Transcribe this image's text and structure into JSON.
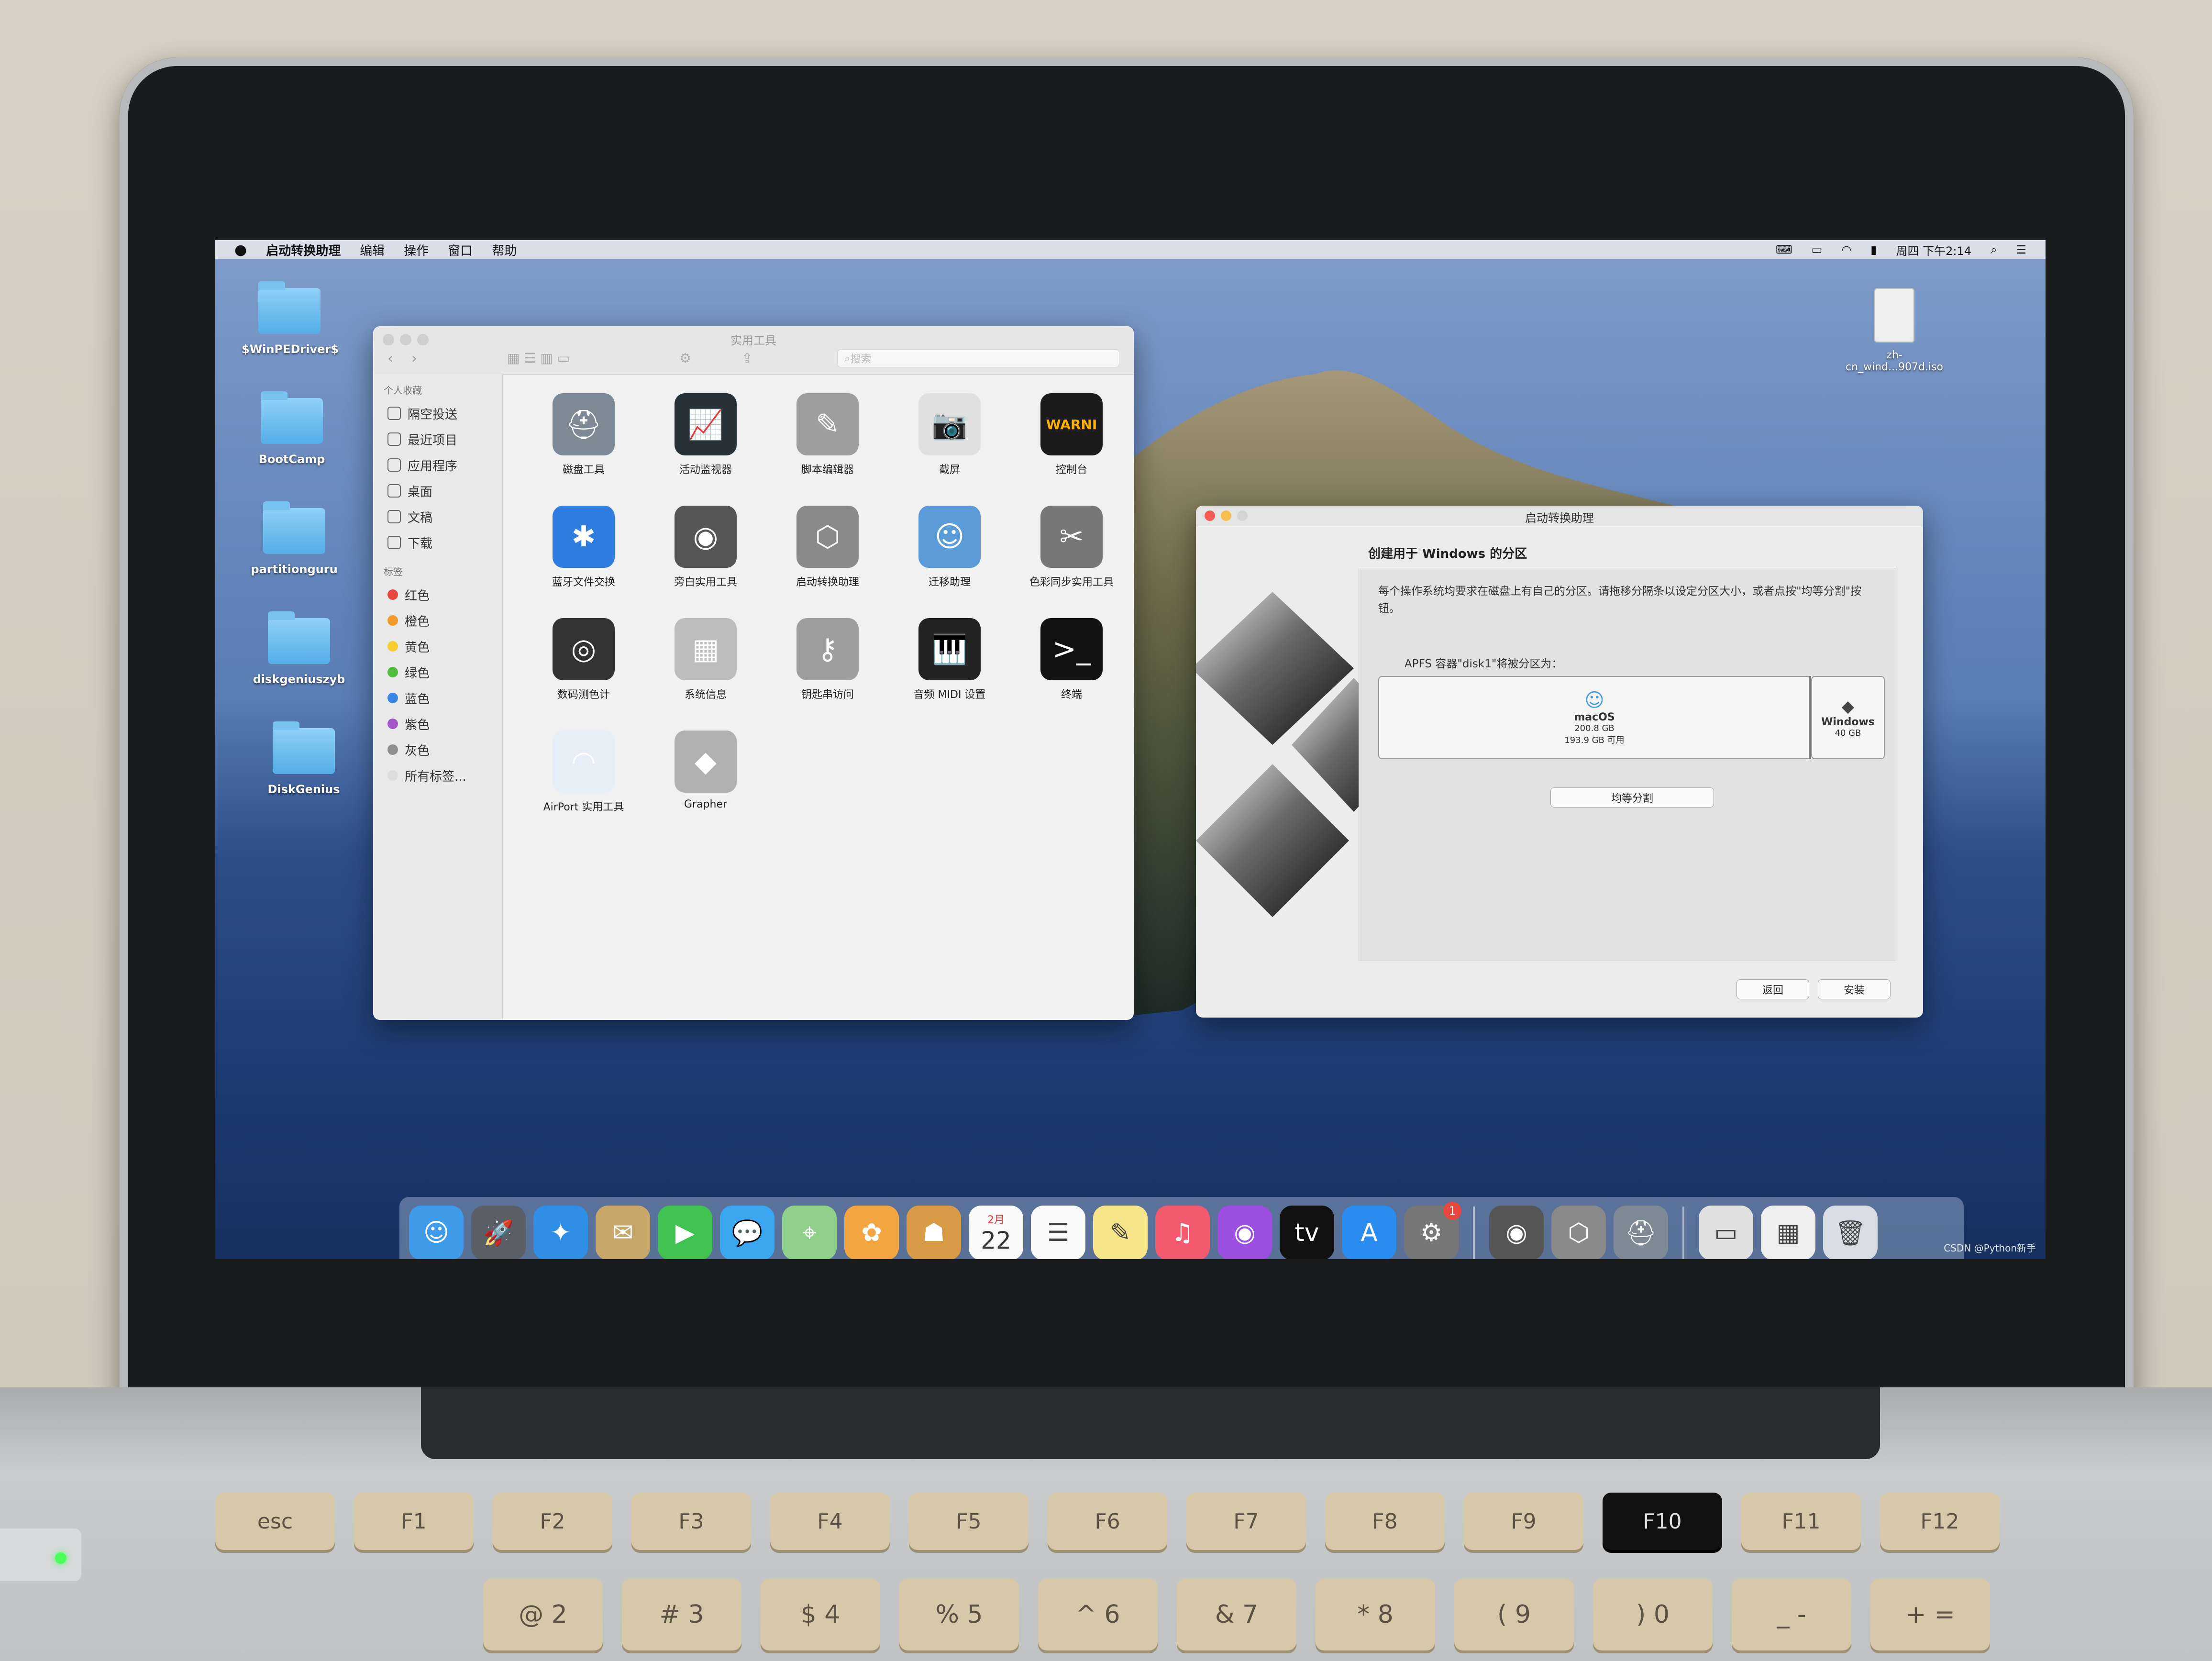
{
  "menubar": {
    "app_name": "启动转换助理",
    "menus": [
      "编辑",
      "操作",
      "窗口",
      "帮助"
    ],
    "clock": "周四 下午2:14"
  },
  "desktop_icons": [
    {
      "label": "$WinPEDriver$"
    },
    {
      "label": "BootCamp"
    },
    {
      "label": "partitionguru"
    },
    {
      "label": "diskgeniuszyb"
    },
    {
      "label": "DiskGenius"
    }
  ],
  "desktop_file": {
    "label_line1": "zh-",
    "label_line2": "cn_wind...907d.iso"
  },
  "finder": {
    "title": "实用工具",
    "search_placeholder": "搜索",
    "sidebar": {
      "favorites_heading": "个人收藏",
      "favorites": [
        "隔空投送",
        "最近项目",
        "应用程序",
        "桌面",
        "文稿",
        "下载"
      ],
      "tags_heading": "标签",
      "tags": [
        {
          "label": "红色",
          "color": "#e8463f"
        },
        {
          "label": "橙色",
          "color": "#f39a2b"
        },
        {
          "label": "黄色",
          "color": "#f5cf30"
        },
        {
          "label": "绿色",
          "color": "#4fbe3d"
        },
        {
          "label": "蓝色",
          "color": "#3a86e6"
        },
        {
          "label": "紫色",
          "color": "#a456c9"
        },
        {
          "label": "灰色",
          "color": "#8e8e8e"
        },
        {
          "label": "所有标签...",
          "color": "#dddddd"
        }
      ]
    },
    "apps": [
      {
        "label": "磁盘工具",
        "icon": "disk-utility-icon",
        "glyph": "⛑",
        "bg": "#7d8a96"
      },
      {
        "label": "活动监视器",
        "icon": "activity-monitor-icon",
        "glyph": "📈",
        "bg": "#263238"
      },
      {
        "label": "脚本编辑器",
        "icon": "script-editor-icon",
        "glyph": "✎",
        "bg": "#9e9e9e"
      },
      {
        "label": "截屏",
        "icon": "screenshot-icon",
        "glyph": "📷",
        "bg": "#e0e0e0"
      },
      {
        "label": "控制台",
        "icon": "console-icon",
        "glyph": "WARNI",
        "bg": "#1c1c1c"
      },
      {
        "label": "蓝牙文件交换",
        "icon": "bluetooth-icon",
        "glyph": "✱",
        "bg": "#2f7de1"
      },
      {
        "label": "旁白实用工具",
        "icon": "voiceover-icon",
        "glyph": "◉",
        "bg": "#555555"
      },
      {
        "label": "启动转换助理",
        "icon": "bootcamp-assistant-icon",
        "glyph": "⬡",
        "bg": "#8a8a8a"
      },
      {
        "label": "迁移助理",
        "icon": "migration-assistant-icon",
        "glyph": "☺",
        "bg": "#5a9bd8"
      },
      {
        "label": "色彩同步实用工具",
        "icon": "colorsync-icon",
        "glyph": "✂",
        "bg": "#777777"
      },
      {
        "label": "数码测色计",
        "icon": "digital-color-meter-icon",
        "glyph": "◎",
        "bg": "#333333"
      },
      {
        "label": "系统信息",
        "icon": "system-information-icon",
        "glyph": "▦",
        "bg": "#bdbdbd"
      },
      {
        "label": "钥匙串访问",
        "icon": "keychain-access-icon",
        "glyph": "⚷",
        "bg": "#9e9e9e"
      },
      {
        "label": "音频 MIDI 设置",
        "icon": "audio-midi-icon",
        "glyph": "🎹",
        "bg": "#222222"
      },
      {
        "label": "终端",
        "icon": "terminal-icon",
        "glyph": ">_",
        "bg": "#111111"
      },
      {
        "label": "AirPort 实用工具",
        "icon": "airport-utility-icon",
        "glyph": "◠",
        "bg": "#e6eef7"
      },
      {
        "label": "Grapher",
        "icon": "grapher-icon",
        "glyph": "◆",
        "bg": "#b0b0b0"
      }
    ]
  },
  "bootcamp": {
    "title": "启动转换助理",
    "heading": "创建用于 Windows 的分区",
    "description": "每个操作系统均要求在磁盘上有自己的分区。请拖移分隔条以设定分区大小，或者点按\"均等分割\"按钮。",
    "apfs_label": "APFS 容器\"disk1\"将被分区为：",
    "mac_partition": {
      "name": "macOS",
      "size": "200.8 GB",
      "free": "193.9 GB 可用"
    },
    "win_partition": {
      "name": "Windows",
      "size": "40 GB"
    },
    "equal_split_label": "均等分割",
    "back_label": "返回",
    "install_label": "安装"
  },
  "dock": {
    "apps": [
      {
        "icon": "finder-icon",
        "glyph": "☺",
        "bg": "#3d9be9"
      },
      {
        "icon": "launchpad-icon",
        "glyph": "🚀",
        "bg": "#5a5f66"
      },
      {
        "icon": "safari-icon",
        "glyph": "✦",
        "bg": "#2f8ee6"
      },
      {
        "icon": "mail-icon",
        "glyph": "✉",
        "bg": "#c8a86a"
      },
      {
        "icon": "facetime-icon",
        "glyph": "▶",
        "bg": "#3fc24f"
      },
      {
        "icon": "messages-icon",
        "glyph": "💬",
        "bg": "#3aa6f0"
      },
      {
        "icon": "maps-icon",
        "glyph": "⌖",
        "bg": "#8fd18a"
      },
      {
        "icon": "photos-icon",
        "glyph": "✿",
        "bg": "#f2a541"
      },
      {
        "icon": "contacts-icon",
        "glyph": "☗",
        "bg": "#d99a46"
      },
      {
        "icon": "calendar-icon",
        "glyph": "22",
        "bg": "#fafafa"
      },
      {
        "icon": "reminders-icon",
        "glyph": "☰",
        "bg": "#fafafa"
      },
      {
        "icon": "notes-icon",
        "glyph": "✎",
        "bg": "#f7e58a"
      },
      {
        "icon": "music-icon",
        "glyph": "♫",
        "bg": "#f35a6e"
      },
      {
        "icon": "podcasts-icon",
        "glyph": "◉",
        "bg": "#9a4fe0"
      },
      {
        "icon": "apple-tv-icon",
        "glyph": "tv",
        "bg": "#111111"
      },
      {
        "icon": "app-store-icon",
        "glyph": "A",
        "bg": "#2b8cf0"
      },
      {
        "icon": "system-preferences-icon",
        "glyph": "⚙",
        "bg": "#777777"
      }
    ],
    "calendar_month": "2月",
    "calendar_day": "22",
    "prefs_badge": "1",
    "recent": [
      {
        "icon": "voiceover-utility-icon",
        "glyph": "◉",
        "bg": "#555555"
      },
      {
        "icon": "bootcamp-assistant-icon",
        "glyph": "⬡",
        "bg": "#8a8a8a"
      },
      {
        "icon": "disk-utility-icon",
        "glyph": "⛑",
        "bg": "#7d8a96"
      }
    ],
    "others": [
      {
        "icon": "iso-document-icon",
        "glyph": "▭",
        "bg": "#e0e0e0"
      },
      {
        "icon": "downloads-stack-icon",
        "glyph": "▦",
        "bg": "#eeeeee"
      },
      {
        "icon": "trash-icon",
        "glyph": "🗑",
        "bg": "#d7dde3"
      }
    ]
  },
  "keyboard": {
    "fn_keys": [
      "esc",
      "F1",
      "F2",
      "F3",
      "F4",
      "F5",
      "F6",
      "F7",
      "F8",
      "F9",
      "F10",
      "F11",
      "F12"
    ],
    "number_keys": [
      "@ 2",
      "# 3",
      "$ 4",
      "% 5",
      "^ 6",
      "& 7",
      "* 8",
      "( 9",
      ") 0",
      "_ -",
      "+ ="
    ]
  },
  "watermark": "CSDN @Python新手"
}
